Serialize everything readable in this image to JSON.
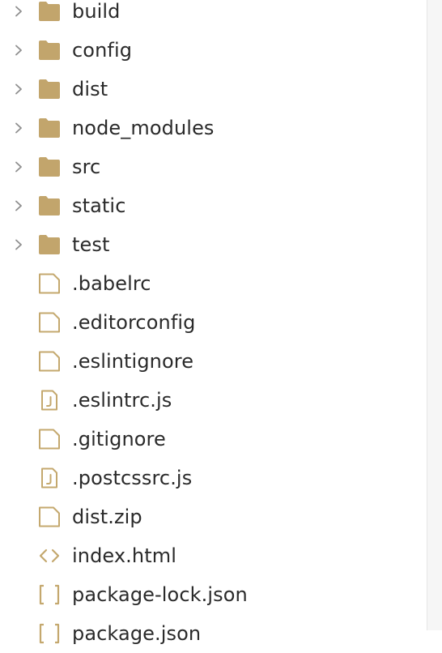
{
  "colors": {
    "folder": "#c2a56c",
    "file_outline": "#c4a86e",
    "chevron": "#8e8e8e",
    "text": "#2a2a2a"
  },
  "tree": {
    "items": [
      {
        "label": "build",
        "kind": "folder",
        "icon": "folder-icon"
      },
      {
        "label": "config",
        "kind": "folder",
        "icon": "folder-icon"
      },
      {
        "label": "dist",
        "kind": "folder",
        "icon": "folder-icon"
      },
      {
        "label": "node_modules",
        "kind": "folder",
        "icon": "folder-icon"
      },
      {
        "label": "src",
        "kind": "folder",
        "icon": "folder-icon"
      },
      {
        "label": "static",
        "kind": "folder",
        "icon": "folder-icon"
      },
      {
        "label": "test",
        "kind": "folder",
        "icon": "folder-icon"
      },
      {
        "label": ".babelrc",
        "kind": "file",
        "icon": "file-icon"
      },
      {
        "label": ".editorconfig",
        "kind": "file",
        "icon": "file-icon"
      },
      {
        "label": ".eslintignore",
        "kind": "file",
        "icon": "file-icon"
      },
      {
        "label": ".eslintrc.js",
        "kind": "js",
        "icon": "js-file-icon"
      },
      {
        "label": ".gitignore",
        "kind": "file",
        "icon": "file-icon"
      },
      {
        "label": ".postcssrc.js",
        "kind": "js",
        "icon": "js-file-icon"
      },
      {
        "label": "dist.zip",
        "kind": "file",
        "icon": "file-icon"
      },
      {
        "label": "index.html",
        "kind": "html",
        "icon": "code-icon"
      },
      {
        "label": "package-lock.json",
        "kind": "json",
        "icon": "brackets-icon"
      },
      {
        "label": "package.json",
        "kind": "json",
        "icon": "brackets-icon"
      }
    ]
  }
}
